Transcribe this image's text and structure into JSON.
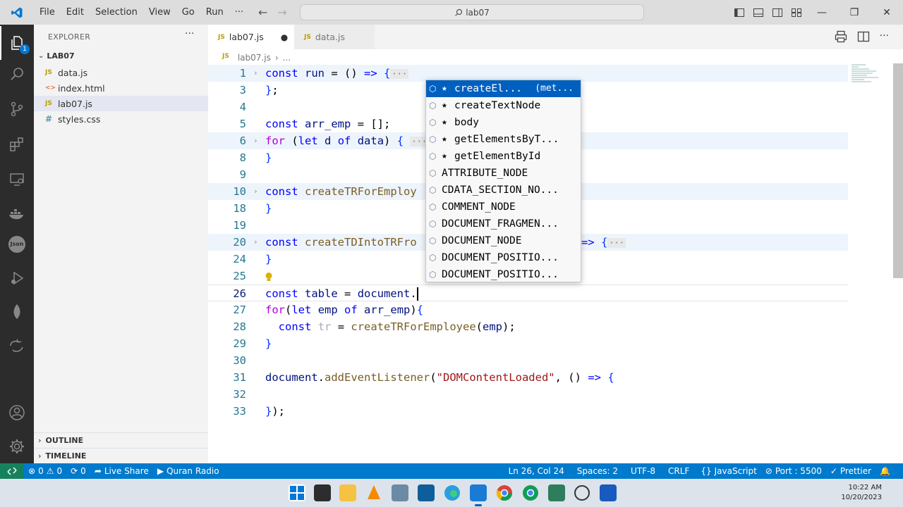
{
  "titlebar": {
    "menu": [
      "File",
      "Edit",
      "Selection",
      "View",
      "Go",
      "Run",
      "···"
    ],
    "search": "lab07"
  },
  "activity": {
    "explorer_badge": "1"
  },
  "sidebar": {
    "title": "EXPLORER",
    "more": "···",
    "folder": "LAB07",
    "files": [
      {
        "icon": "JS",
        "name": "data.js"
      },
      {
        "icon": "<>",
        "name": "index.html"
      },
      {
        "icon": "JS",
        "name": "lab07.js"
      },
      {
        "icon": "#",
        "name": "styles.css"
      }
    ],
    "outline": "OUTLINE",
    "timeline": "TIMELINE"
  },
  "tabs": [
    {
      "icon": "JS",
      "label": "lab07.js",
      "dirty": "●"
    },
    {
      "icon": "JS",
      "label": "data.js"
    }
  ],
  "breadcrumb": {
    "icon": "JS",
    "file": "lab07.js",
    "sep": "›",
    "rest": "..."
  },
  "code": {
    "line_numbers": [
      "1",
      "3",
      "4",
      "5",
      "6",
      "8",
      "9",
      "10",
      "18",
      "19",
      "20",
      "24",
      "25",
      "26",
      "27",
      "28",
      "29",
      "30",
      "31",
      "32",
      "33"
    ],
    "fold_marker": "›",
    "collapsed": "···"
  },
  "suggest": {
    "items": [
      {
        "label": "createEl...",
        "detail": "(met..."
      },
      {
        "label": "createTextNode"
      },
      {
        "label": "body"
      },
      {
        "label": "getElementsByT..."
      },
      {
        "label": "getElementById"
      },
      {
        "label": "ATTRIBUTE_NODE"
      },
      {
        "label": "CDATA_SECTION_NO..."
      },
      {
        "label": "COMMENT_NODE"
      },
      {
        "label": "DOCUMENT_FRAGMEN..."
      },
      {
        "label": "DOCUMENT_NODE"
      },
      {
        "label": "DOCUMENT_POSITIO..."
      },
      {
        "label": "DOCUMENT_POSITIO..."
      }
    ]
  },
  "status": {
    "errors": "0",
    "warnings": "0",
    "ports": "0",
    "live_share": "Live Share",
    "quran": "Quran Radio",
    "position": "Ln 26, Col 24",
    "spaces": "Spaces: 2",
    "encoding": "UTF-8",
    "eol": "CRLF",
    "language": "JavaScript",
    "port": "Port : 5500",
    "prettier": "Prettier"
  },
  "clock": {
    "time": "10:22 AM",
    "date": "10/20/2023"
  },
  "colors": {
    "accent": "#007acc",
    "remote": "#16825d",
    "selection": "#0060c0"
  }
}
